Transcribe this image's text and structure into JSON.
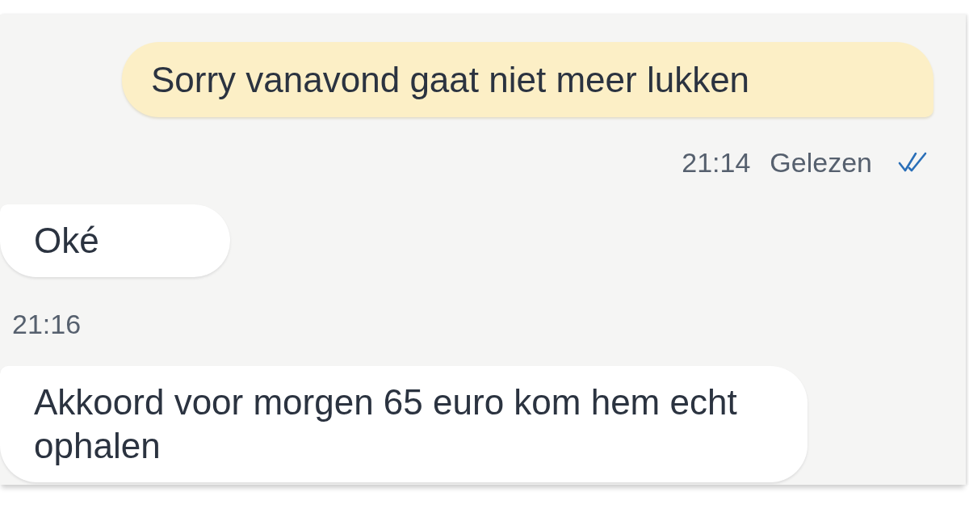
{
  "messages": [
    {
      "kind": "outgoing",
      "text": "Sorry vanavond gaat niet meer lukken",
      "time": "21:14",
      "status": "Gelezen",
      "read": true
    },
    {
      "kind": "incoming",
      "text": "Oké",
      "time": "21:16"
    },
    {
      "kind": "incoming",
      "text": "Akkoord voor morgen 65 euro kom hem echt ophalen"
    }
  ]
}
